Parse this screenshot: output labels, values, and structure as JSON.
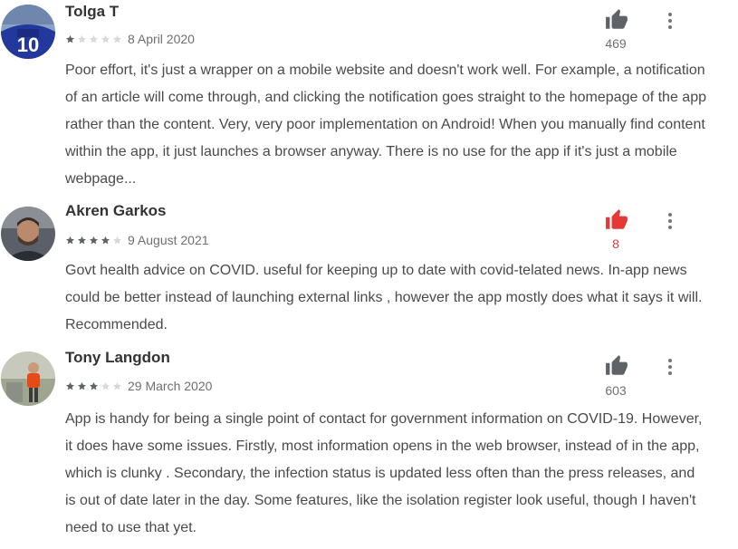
{
  "reviews": [
    {
      "author": "Tolga T",
      "rating": 1,
      "date": "8 April 2020",
      "helpful_count": "469",
      "helpful_active": false,
      "text": "Poor effort, it's just a wrapper on a mobile website and doesn't work well. For example, a notification of an article will come through, and clicking the notification goes straight to the homepage of the app rather than the content. Very, very poor implementation on Android! When you manually find content within the app, it just launches a browser anyway. There is no use for the app if it's just a mobile webpage..."
    },
    {
      "author": "Akren Garkos",
      "rating": 4,
      "date": "9 August 2021",
      "helpful_count": "8",
      "helpful_active": true,
      "text": "Govt health advice on COVID. useful for keeping up to date with covid-telated news. In-app news could be better instead of launching external links , however the app mostly does what it says it will. Recommended."
    },
    {
      "author": "Tony Langdon",
      "rating": 3,
      "date": "29 March 2020",
      "helpful_count": "603",
      "helpful_active": false,
      "text": "App is handy for being a single point of contact for government information on COVID-19. However, it does have some issues. Firstly, most information opens in the web browser, instead of in the app, which is clunky . Secondary, the infection status is updated less often than the press releases, and is out of date later in the day. Some features, like the isolation register look useful, though I haven't need to use that yet."
    }
  ],
  "icons": {
    "helpful": "thumb-up-icon",
    "more": "more-vert-icon",
    "star": "star-icon"
  },
  "colors": {
    "star_filled": "#5f6368",
    "star_empty": "#d8d8d8",
    "thumb_default": "#5f6368",
    "thumb_active": "#e53935"
  }
}
